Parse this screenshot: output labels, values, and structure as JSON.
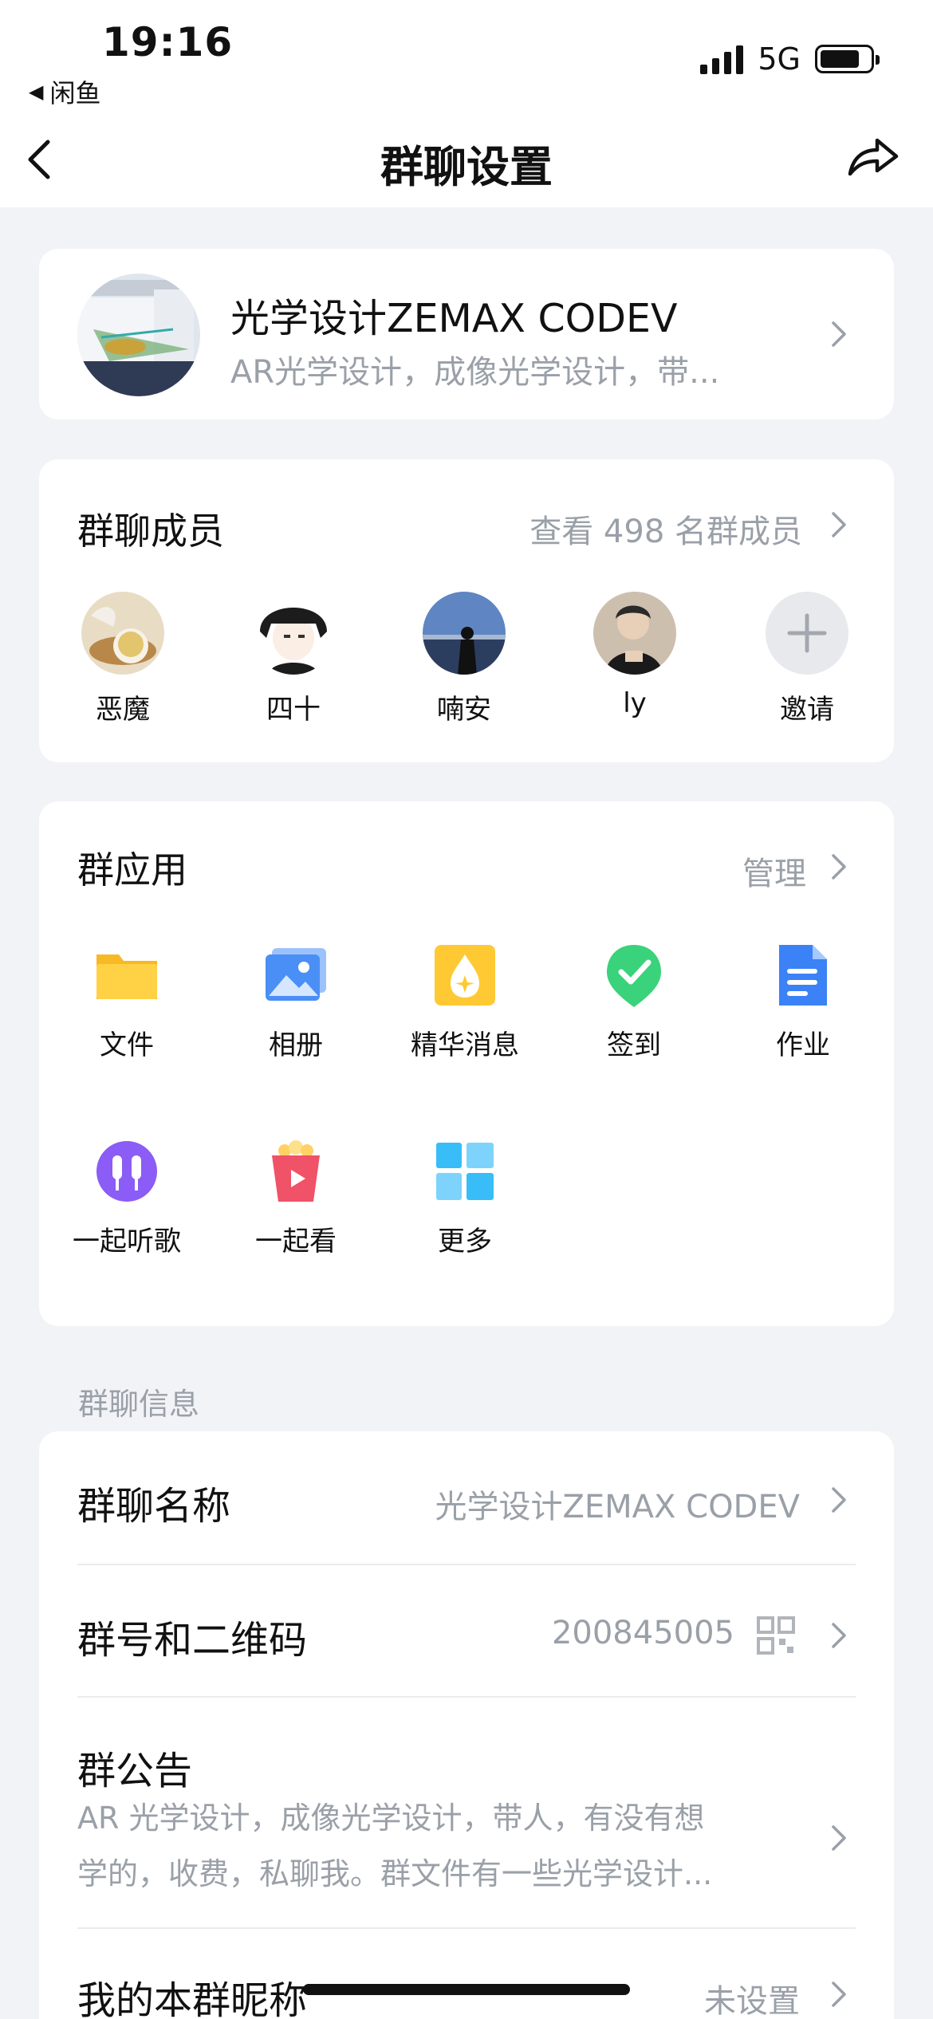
{
  "status": {
    "time": "19:16",
    "back_app": "闲鱼",
    "network": "5G",
    "battery_level": 0.8
  },
  "nav": {
    "title": "群聊设置",
    "back_icon": "chevron-left-icon",
    "share_icon": "share-icon"
  },
  "group": {
    "name": "光学设计ZEMAX CODEV",
    "description": "AR光学设计，成像光学设计，带..."
  },
  "members": {
    "title": "群聊成员",
    "view_all": "查看 498 名群成员",
    "list": [
      {
        "name": "恶魔",
        "color": "#c9a15b"
      },
      {
        "name": "四十",
        "color": "#222222"
      },
      {
        "name": "喃安",
        "color": "#4a6fa5"
      },
      {
        "name": "ly",
        "color": "#3a3a3a"
      }
    ],
    "invite_label": "邀请"
  },
  "apps": {
    "title": "群应用",
    "manage": "管理",
    "items": [
      {
        "label": "文件",
        "icon": "folder-icon",
        "color": "#ffc933"
      },
      {
        "label": "相册",
        "icon": "photo-album-icon",
        "color": "#4a8ff5"
      },
      {
        "label": "精华消息",
        "icon": "essence-icon",
        "color": "#ffc933"
      },
      {
        "label": "签到",
        "icon": "checkin-icon",
        "color": "#3ad27a"
      },
      {
        "label": "作业",
        "icon": "homework-icon",
        "color": "#3b82f6"
      },
      {
        "label": "一起听歌",
        "icon": "music-icon",
        "color": "#8b5cf6"
      },
      {
        "label": "一起看",
        "icon": "watch-together-icon",
        "color": "#f05267"
      },
      {
        "label": "更多",
        "icon": "more-apps-icon",
        "color": "#38bdf8"
      }
    ]
  },
  "info": {
    "section_label": "群聊信息",
    "name_label": "群聊名称",
    "name_value": "光学设计ZEMAX CODEV",
    "number_label": "群号和二维码",
    "number_value": "200845005",
    "notice_label": "群公告",
    "notice_line1": "AR 光学设计，成像光学设计，带人，有没有想",
    "notice_line2": "学的，收费，私聊我。群文件有一些光学设计...",
    "nickname_label": "我的本群昵称",
    "nickname_value": "未设置"
  }
}
